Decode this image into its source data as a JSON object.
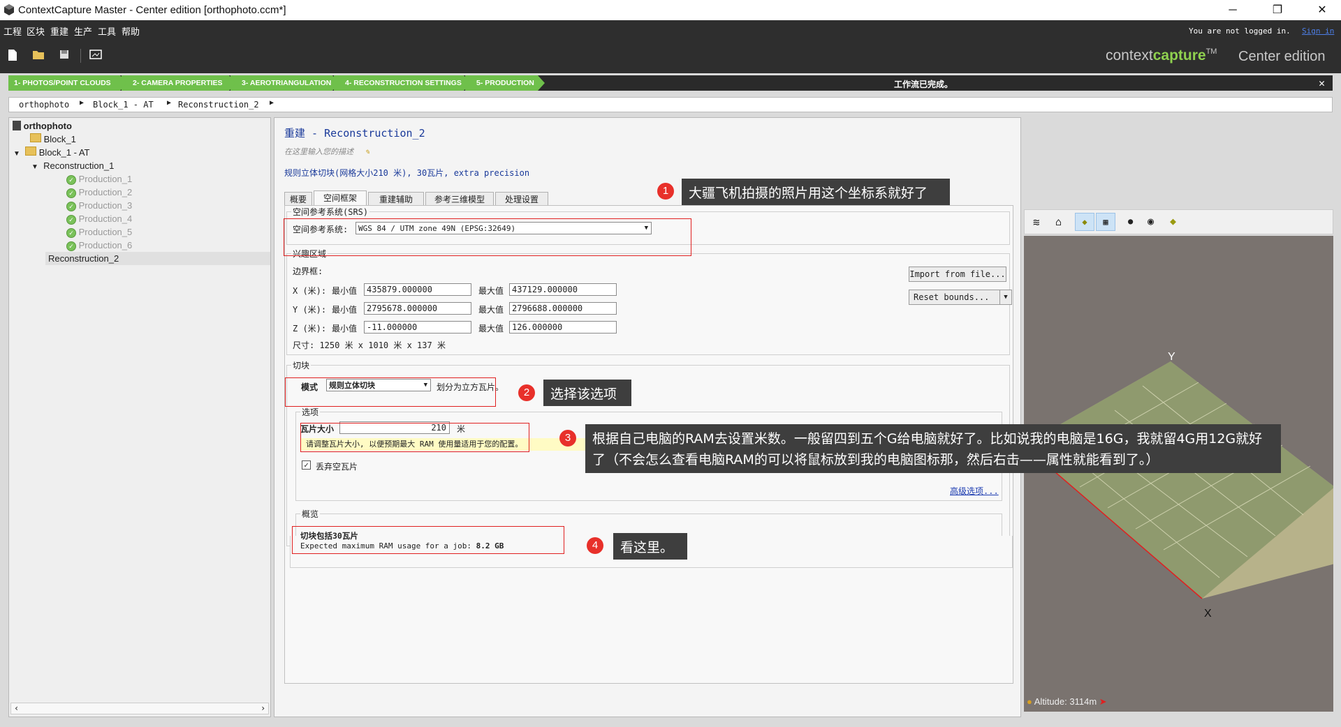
{
  "window": {
    "title": "ContextCapture Master - Center edition [orthophoto.ccm*]"
  },
  "menu": [
    "工程",
    "区块",
    "重建",
    "生产",
    "工具",
    "帮助"
  ],
  "login": {
    "text": "You are not logged in.",
    "link": "Sign in"
  },
  "brand": {
    "context": "context",
    "capture": "capture",
    "tm": "TM",
    "edition": "Center edition"
  },
  "steps": [
    "1- PHOTOS/POINT CLOUDS",
    "2- CAMERA PROPERTIES",
    "3- AEROTRIANGULATION",
    "4- RECONSTRUCTION SETTINGS",
    "5- PRODUCTION"
  ],
  "status": "工作流已完成。",
  "breadcrumb": [
    "orthophoto",
    "Block_1 - AT",
    "Reconstruction_2"
  ],
  "tree": {
    "root": "orthophoto",
    "block1": "Block_1",
    "blockAT": "Block_1 - AT",
    "recon1": "Reconstruction_1",
    "productions": [
      "Production_1",
      "Production_2",
      "Production_3",
      "Production_4",
      "Production_5",
      "Production_6"
    ],
    "recon2": "Reconstruction_2"
  },
  "header": {
    "title_prefix": "重建",
    "title_sep": " - ",
    "title_name": "Reconstruction_2",
    "desc_placeholder": "在这里输入您的描述",
    "summary": "规则立体切块(网格大小210 米), 30瓦片, extra precision"
  },
  "tabs": [
    "概要",
    "空间框架",
    "重建辅助",
    "参考三维模型",
    "处理设置"
  ],
  "srs": {
    "group": "空间参考系统(SRS)",
    "label": "空间参考系统:",
    "value": "WGS 84 / UTM zone 49N (EPSG:32649)"
  },
  "roi": {
    "group": "兴趣区域",
    "bounds_label": "边界框:",
    "rows": [
      {
        "axis": "X (米):",
        "min_label": "最小值",
        "min": "435879.000000",
        "max_label": "最大值",
        "max": "437129.000000"
      },
      {
        "axis": "Y (米):",
        "min_label": "最小值",
        "min": "2795678.000000",
        "max_label": "最大值",
        "max": "2796688.000000"
      },
      {
        "axis": "Z (米):",
        "min_label": "最小值",
        "min": "-11.000000",
        "max_label": "最大值",
        "max": "126.000000"
      }
    ],
    "size": "尺寸: 1250 米 x 1010 米 x 137 米",
    "import_btn": "Import from file...",
    "reset_btn": "Reset bounds..."
  },
  "tiling": {
    "group": "切块",
    "mode_label": "模式",
    "mode_value": "规则立体切块",
    "mode_desc": "划分为立方瓦片。",
    "options_group": "选项",
    "tile_size_label": "瓦片大小",
    "tile_size_value": "210",
    "tile_unit": "米",
    "hint": "请调整瓦片大小, 以便预期最大 RAM 使用量适用于您的配置。",
    "discard_label": "丢弃空瓦片",
    "discard_checked": true,
    "advanced_link": "高级选项..."
  },
  "overview": {
    "group": "概览",
    "line1": "切块包括30瓦片",
    "line2_prefix": "Expected maximum RAM usage for a job: ",
    "line2_value": "8.2 GB"
  },
  "viewer": {
    "altitude_label": "Altitude:",
    "altitude_value": "3114m",
    "axis_x": "X",
    "axis_y": "Y"
  },
  "callouts": [
    {
      "num": "1",
      "text": "大疆飞机拍摄的照片用这个坐标系就好了"
    },
    {
      "num": "2",
      "text": "选择该选项"
    },
    {
      "num": "3",
      "text": "根据自己电脑的RAM去设置米数。一般留四到五个G给电脑就好了。比如说我的电脑是16G，我就留4G用12G就好了（不会怎么查看电脑RAM的可以将鼠标放到我的电脑图标那，然后右击——属性就能看到了。）"
    },
    {
      "num": "4",
      "text": "看这里。"
    }
  ],
  "colors": {
    "step_green": "#6fc04b",
    "accent_blue": "#1a3a9a",
    "callout_red": "#e8302a"
  }
}
